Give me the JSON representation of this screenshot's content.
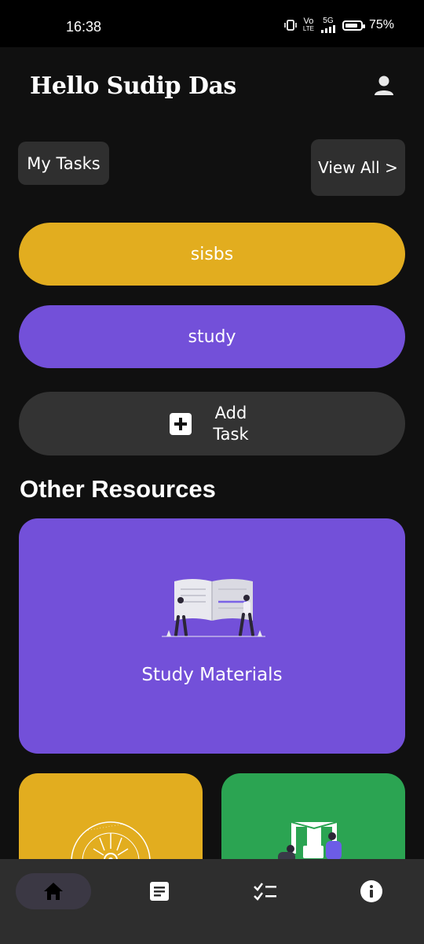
{
  "status_bar": {
    "time": "16:38",
    "sim_label_top": "Vo",
    "sim_label_bottom": "LTE",
    "network": "5G",
    "battery": "75%",
    "icons": [
      "vibrate-icon",
      "volte-icon",
      "signal-icon",
      "battery-icon"
    ]
  },
  "header": {
    "greeting": "Hello Sudip Das",
    "profile_icon": "person-icon"
  },
  "tasks": {
    "section_label": "My Tasks",
    "view_all_label": "View All >",
    "items": [
      {
        "label": "sisbs",
        "color": "#e2ad1f"
      },
      {
        "label": "study",
        "color": "#7350d9"
      }
    ],
    "add_label": "Add Task",
    "add_icon": "plus-box-icon"
  },
  "resources": {
    "title": "Other Resources",
    "cards": [
      {
        "label": "Study Materials",
        "color": "#7350d9",
        "illustration": "reading-book-illustration"
      },
      {
        "label": "",
        "color": "#e2ad1f",
        "illustration": "society-logo-seal"
      },
      {
        "label": "",
        "color": "#2ba452",
        "illustration": "people-working-illustration"
      }
    ]
  },
  "bottom_nav": {
    "items": [
      {
        "icon": "home-icon",
        "active": true
      },
      {
        "icon": "notes-icon",
        "active": false
      },
      {
        "icon": "checklist-icon",
        "active": false
      },
      {
        "icon": "info-icon",
        "active": false
      }
    ],
    "active_color": "#3b3844"
  }
}
